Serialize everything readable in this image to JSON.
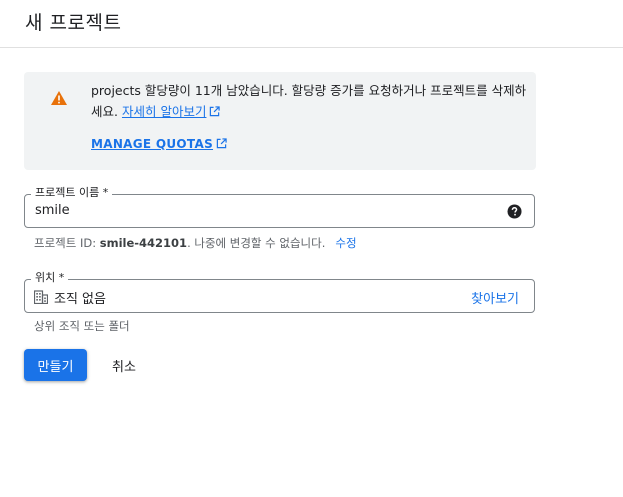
{
  "header": {
    "title": "새 프로젝트"
  },
  "quota_notice": {
    "message": "projects 할당량이 11개 남았습니다. 할당량 증가를 요청하거나 프로젝트를 삭제하세요.",
    "learn_more": "자세히 알아보기",
    "manage_quotas": "MANAGE QUOTAS",
    "icon": "warning-icon",
    "icon_color": "#e8710a"
  },
  "project_name": {
    "label": "프로젝트 이름 *",
    "value": "smile",
    "help_icon": "help-circle-icon",
    "hint_prefix": "프로젝트 ID: ",
    "project_id": "smile-442101",
    "hint_suffix": ". 나중에 변경할 수 없습니다.",
    "edit_label": "수정"
  },
  "location": {
    "label": "위치 *",
    "value": "조직 없음",
    "icon": "building-icon",
    "browse_label": "찾아보기",
    "hint": "상위 조직 또는 폴더"
  },
  "actions": {
    "create_label": "만들기",
    "cancel_label": "취소",
    "accent_color": "#1a73e8"
  }
}
